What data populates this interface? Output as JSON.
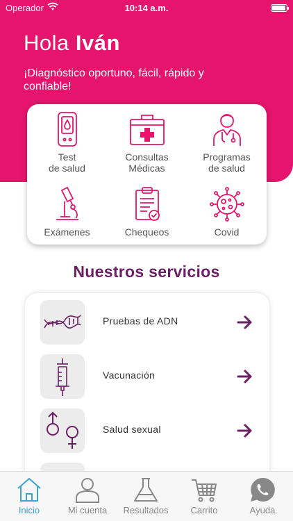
{
  "status_bar": {
    "carrier": "Operador",
    "time": "10:14 a.m."
  },
  "header": {
    "greeting_prefix": "Hola",
    "user_name": "Iván",
    "tagline": "¡Diagnóstico oportuno, fácil, rápido y confiable!"
  },
  "quick_actions": [
    {
      "line1": "Test",
      "line2": "de salud",
      "icon": "blood-test-icon"
    },
    {
      "line1": "Consultas",
      "line2": "Médicas",
      "icon": "medical-kit-icon"
    },
    {
      "line1": "Programas",
      "line2": "de salud",
      "icon": "doctor-icon"
    },
    {
      "line1": "Exámenes",
      "line2": "",
      "icon": "microscope-icon"
    },
    {
      "line1": "Chequeos",
      "line2": "",
      "icon": "clipboard-check-icon"
    },
    {
      "line1": "Covid",
      "line2": "",
      "icon": "virus-icon"
    }
  ],
  "services": {
    "title": "Nuestros servicios",
    "items": [
      {
        "label": "Pruebas de ADN",
        "icon": "dna-icon"
      },
      {
        "label": "Vacunación",
        "icon": "syringe-icon"
      },
      {
        "label": "Salud sexual",
        "icon": "gender-symbols-icon"
      }
    ]
  },
  "tabbar": {
    "items": [
      {
        "label": "Inicio",
        "icon": "home-icon",
        "active": true
      },
      {
        "label": "Mi cuenta",
        "icon": "user-icon",
        "active": false
      },
      {
        "label": "Resultados",
        "icon": "flask-icon",
        "active": false
      },
      {
        "label": "Carrito",
        "icon": "cart-icon",
        "active": false
      },
      {
        "label": "Ayuda",
        "icon": "whatsapp-icon",
        "active": false
      }
    ]
  },
  "colors": {
    "brand": "#e5156d",
    "section_title": "#6b1f64",
    "accent_icon": "#6b1f64",
    "active_tab": "#3aa5d6"
  }
}
